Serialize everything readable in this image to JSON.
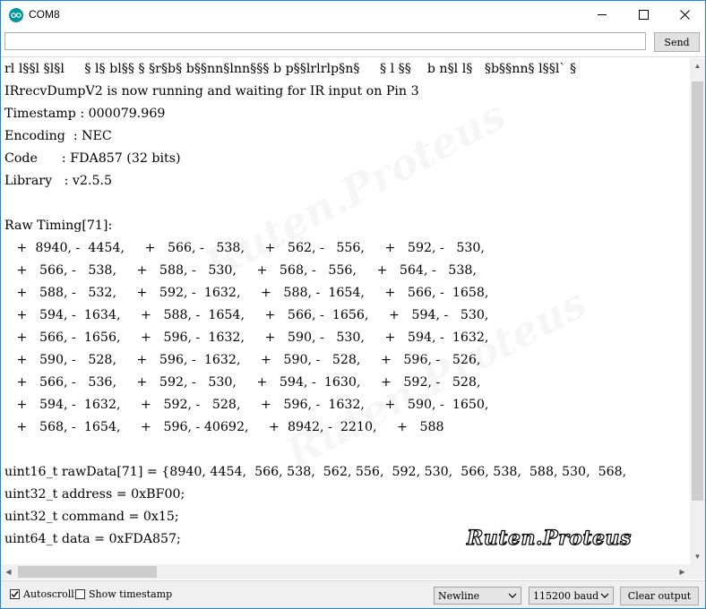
{
  "window": {
    "title": "COM8"
  },
  "send": {
    "input_value": "",
    "button_label": "Send"
  },
  "output_lines": [
    "rl l§§l §l§l     § l§ bl§§ § §r§b§ b§§nn§lnn§§§ b p§§lrlrlp§n§     § l §§    b n§l l§   §b§§nn§ l§§l` §",
    "IRrecvDumpV2 is now running and waiting for IR input on Pin 3",
    "Timestamp : 000079.969",
    "Encoding  : NEC",
    "Code      : FDA857 (32 bits)",
    "Library   : v2.5.5",
    "",
    "Raw Timing[71]:",
    "   +  8940, -  4454,     +   566, -   538,     +   562, -   556,     +   592, -   530,",
    "   +   566, -   538,     +   588, -   530,     +   568, -   556,     +   564, -   538,",
    "   +   588, -   532,     +   592, -  1632,     +   588, -  1654,     +   566, -  1658,",
    "   +   594, -  1634,     +   588, -  1654,     +   566, -  1656,     +   594, -   530,",
    "   +   566, -  1656,     +   596, -  1632,     +   590, -   530,     +   594, -  1632,",
    "   +   590, -   528,     +   596, -  1632,     +   590, -   528,     +   596, -   526,",
    "   +   566, -   536,     +   592, -   530,     +   594, -  1630,     +   592, -   528,",
    "   +   594, -  1632,     +   592, -   528,     +   596, -  1632,     +   590, -  1650,",
    "   +   568, -  1654,     +   596, - 40692,     +  8942, -  2210,     +   588",
    "",
    "uint16_t rawData[71] = {8940, 4454,  566, 538,  562, 556,  592, 530,  566, 538,  588, 530,  568,",
    "uint32_t address = 0xBF00;",
    "uint32_t command = 0x15;",
    "uint64_t data = 0xFDA857;"
  ],
  "watermark": "Ruten.Proteus",
  "footer": {
    "autoscroll_label": "Autoscroll",
    "autoscroll_checked": true,
    "timestamp_label": "Show timestamp",
    "timestamp_checked": false,
    "line_ending": "Newline",
    "baud_rate": "115200 baud",
    "clear_label": "Clear output"
  },
  "icons": {
    "app": "arduino-icon",
    "minimize": "minimize-icon",
    "maximize": "maximize-icon",
    "close": "close-icon",
    "dropdown": "chevron-down-icon",
    "checkmark": "checkmark-icon"
  },
  "colors": {
    "window_border": "#1a86d8",
    "app_icon": "#00979c",
    "chrome": "#f0f0f0"
  }
}
